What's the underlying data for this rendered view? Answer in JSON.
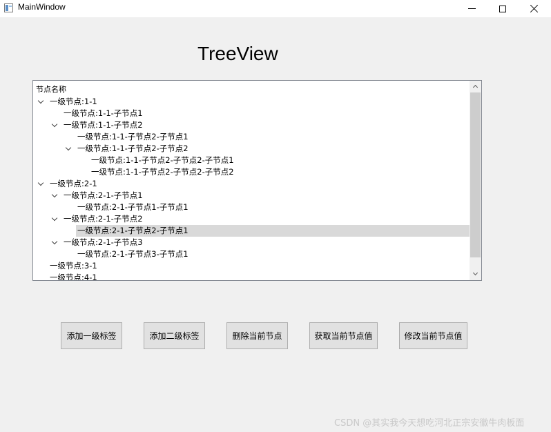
{
  "window": {
    "title": "MainWindow"
  },
  "heading": "TreeView",
  "tree": {
    "header": "节点名称",
    "rows": [
      {
        "label": "一级节点:1-1",
        "level": 0,
        "expanded": true,
        "selected": false
      },
      {
        "label": "一级节点:1-1-子节点1",
        "level": 1,
        "expanded": null,
        "selected": false
      },
      {
        "label": "一级节点:1-1-子节点2",
        "level": 1,
        "expanded": true,
        "selected": false
      },
      {
        "label": "一级节点:1-1-子节点2-子节点1",
        "level": 2,
        "expanded": null,
        "selected": false
      },
      {
        "label": "一级节点:1-1-子节点2-子节点2",
        "level": 2,
        "expanded": true,
        "selected": false
      },
      {
        "label": "一级节点:1-1-子节点2-子节点2-子节点1",
        "level": 3,
        "expanded": null,
        "selected": false
      },
      {
        "label": "一级节点:1-1-子节点2-子节点2-子节点2",
        "level": 3,
        "expanded": null,
        "selected": false
      },
      {
        "label": "一级节点:2-1",
        "level": 0,
        "expanded": true,
        "selected": false
      },
      {
        "label": "一级节点:2-1-子节点1",
        "level": 1,
        "expanded": true,
        "selected": false
      },
      {
        "label": "一级节点:2-1-子节点1-子节点1",
        "level": 2,
        "expanded": null,
        "selected": false
      },
      {
        "label": "一级节点:2-1-子节点2",
        "level": 1,
        "expanded": true,
        "selected": false
      },
      {
        "label": "一级节点:2-1-子节点2-子节点1",
        "level": 2,
        "expanded": null,
        "selected": true
      },
      {
        "label": "一级节点:2-1-子节点3",
        "level": 1,
        "expanded": true,
        "selected": false
      },
      {
        "label": "一级节点:2-1-子节点3-子节点1",
        "level": 2,
        "expanded": null,
        "selected": false
      },
      {
        "label": "一级节点:3-1",
        "level": 0,
        "expanded": null,
        "selected": false
      },
      {
        "label": "一级节点:4-1",
        "level": 0,
        "expanded": null,
        "selected": false
      }
    ]
  },
  "buttons": {
    "add_level1": "添加一级标签",
    "add_level2": "添加二级标签",
    "delete_node": "删除当前节点",
    "get_value": "获取当前节点值",
    "edit_value": "修改当前节点值"
  },
  "watermark": "CSDN @其实我今天想吃河北正宗安徽牛肉板面"
}
